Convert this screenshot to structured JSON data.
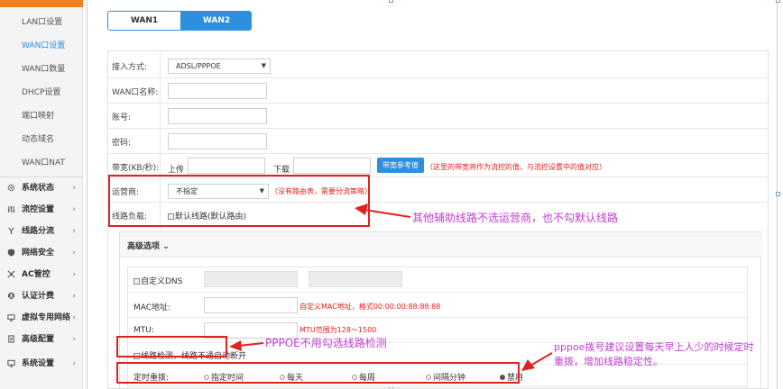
{
  "sidebar": {
    "sub_items": [
      "LAN口设置",
      "WAN口设置",
      "WAN口数量",
      "DHCP设置",
      "端口映射",
      "动态域名",
      "WAN口NAT"
    ],
    "active_sub": "WAN口设置",
    "main_items": [
      {
        "label": "系统状态",
        "icon": "gear-icon"
      },
      {
        "label": "流控设置",
        "icon": "sliders-icon"
      },
      {
        "label": "线路分流",
        "icon": "fork-icon"
      },
      {
        "label": "网络安全",
        "icon": "shield-icon"
      },
      {
        "label": "AC管控",
        "icon": "network-icon"
      },
      {
        "label": "认证计费",
        "icon": "user-badge-icon"
      },
      {
        "label": "虚拟专用网络",
        "icon": "vpn-icon"
      },
      {
        "label": "高级配置",
        "icon": "document-icon"
      },
      {
        "label": "系统设置",
        "icon": "monitor-icon"
      }
    ]
  },
  "tabs": {
    "wan1": "WAN1",
    "wan2": "WAN2"
  },
  "form": {
    "access_mode_label": "接入方式:",
    "access_mode_value": "ADSL/PPPOE",
    "wan_name_label": "WAN口名称:",
    "account_label": "账号:",
    "password_label": "密码:",
    "bandwidth_label": "带宽(KB/秒):",
    "upload_label": "上传",
    "download_label": "下载",
    "bandwidth_ref_button": "带宽参考值",
    "bandwidth_hint": "（这里的带宽将作为流控的值，与流控设置中的值对应）",
    "isp_label": "运营商:",
    "isp_value": "不指定",
    "isp_hint": "（没有路由表，需要分流策略）",
    "line_load_label": "线路负载:",
    "default_line_label": "默认线路(默认路由)"
  },
  "advanced": {
    "title": "高级选项",
    "custom_dns_label": "自定义DNS",
    "mac_label": "MAC地址:",
    "mac_hint": "自定义MAC地址，格式00:00:00:88:88:88",
    "mtu_label": "MTU:",
    "mtu_hint": "MTU范围为128～1500",
    "line_detect_label": "线路检测，线路不通自动断开",
    "redial_label": "定时重拨:",
    "redial_options": [
      "指定时间",
      "每天",
      "每周",
      "间隔分钟",
      "禁用"
    ],
    "redial_selected": "禁用"
  },
  "annotations": {
    "note1": "其他辅助线路不选运营商，也不勾默认线路",
    "note2": "PPPOE不用勾选线路检测",
    "note3_line1": "pppoe拨号建议设置每天早上人少的时候定时",
    "note3_line2": "重拨，增加线路稳定性。"
  },
  "colors": {
    "accent": "#2c8fe0",
    "sidebar_active": "#f0801e",
    "annotation_border": "#e0221e",
    "annotation_text": "#c23bd4"
  }
}
